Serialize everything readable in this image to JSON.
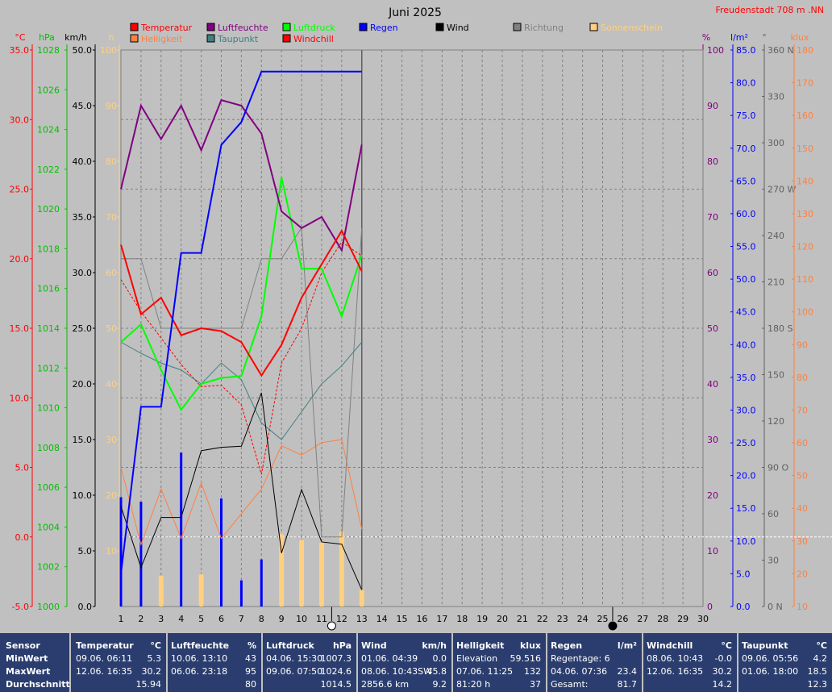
{
  "header": {
    "title": "Juni 2025",
    "location": "Freudenstadt 708 m  .NN"
  },
  "legend": [
    {
      "label": "Temperatur",
      "color": "#ff0000"
    },
    {
      "label": "Luftfeuchte",
      "color": "#800080"
    },
    {
      "label": "Luftdruck",
      "color": "#00ff00"
    },
    {
      "label": "Regen",
      "color": "#0000ff"
    },
    {
      "label": "Wind",
      "color": "#000000"
    },
    {
      "label": "Richtung",
      "color": "#808080"
    },
    {
      "label": "Sonnenschein",
      "color": "#ffd080"
    },
    {
      "label": "Helligkeit",
      "color": "#ff8040"
    },
    {
      "label": "Taupunkt",
      "color": "#408080"
    },
    {
      "label": "Windchill",
      "color": "#ff0000"
    }
  ],
  "axes": {
    "temp": {
      "unit": "°C",
      "ticks": [
        "35.0",
        "30.0",
        "25.0",
        "20.0",
        "15.0",
        "10.0",
        "5.0",
        "0.0",
        "-5.0"
      ],
      "color": "#ff0000"
    },
    "press": {
      "unit": "hPa",
      "ticks": [
        "1028",
        "1026",
        "1024",
        "1022",
        "1020",
        "1018",
        "1016",
        "1014",
        "1012",
        "1010",
        "1008",
        "1006",
        "1004",
        "1002",
        "1000"
      ],
      "color": "#00c000"
    },
    "wind": {
      "unit": "km/h",
      "ticks": [
        "50.0",
        "45.0",
        "40.0",
        "35.0",
        "30.0",
        "25.0",
        "20.0",
        "15.0",
        "10.0",
        "5.0",
        "0.0"
      ],
      "color": "#000000"
    },
    "sun": {
      "unit": "h",
      "ticks": [
        "100",
        "90",
        "80",
        "70",
        "60",
        "50",
        "40",
        "30",
        "20",
        "10"
      ],
      "color": "#ffd080"
    },
    "hum": {
      "unit": "%",
      "ticks": [
        "100",
        "90",
        "80",
        "70",
        "60",
        "50",
        "40",
        "30",
        "20",
        "10",
        "0"
      ],
      "color": "#800080"
    },
    "rain": {
      "unit": "l/m²",
      "ticks": [
        "85.0",
        "80.0",
        "75.0",
        "70.0",
        "65.0",
        "60.0",
        "55.0",
        "50.0",
        "45.0",
        "40.0",
        "35.0",
        "30.0",
        "25.0",
        "20.0",
        "15.0",
        "10.0",
        "5.0",
        "0.0"
      ],
      "color": "#0000ff"
    },
    "dir": {
      "unit": "°",
      "ticks": [
        "360 N",
        "330",
        "300",
        "270 W",
        "240",
        "210",
        "180 S",
        "150",
        "120",
        "90  O",
        "60",
        "30",
        "0   N"
      ],
      "color": "#606060"
    },
    "lux": {
      "unit": "klux",
      "ticks": [
        "180",
        "170",
        "160",
        "150",
        "140",
        "130",
        "120",
        "110",
        "100",
        "90",
        "80",
        "70",
        "60",
        "50",
        "40",
        "30",
        "20",
        "10"
      ],
      "color": "#ff8040"
    },
    "days": [
      "1",
      "2",
      "3",
      "4",
      "5",
      "6",
      "7",
      "8",
      "9",
      "10",
      "11",
      "12",
      "13",
      "14",
      "15",
      "16",
      "17",
      "18",
      "19",
      "20",
      "21",
      "22",
      "23",
      "24",
      "25",
      "26",
      "27",
      "28",
      "29",
      "30"
    ]
  },
  "chart_data": {
    "type": "line",
    "title": "Juni 2025",
    "x": [
      1,
      2,
      3,
      4,
      5,
      6,
      7,
      8,
      9,
      10,
      11,
      12,
      13
    ],
    "xlim": [
      1,
      30
    ],
    "grid": true,
    "series": [
      {
        "name": "Temperatur",
        "unit": "°C",
        "color": "#ff0000",
        "width": 2,
        "ylim": [
          -5,
          35
        ],
        "values": [
          21.0,
          16.0,
          17.2,
          14.5,
          15.0,
          14.8,
          14.0,
          11.6,
          13.8,
          17.2,
          19.6,
          22.0,
          19.1
        ]
      },
      {
        "name": "Windchill",
        "unit": "°C",
        "color": "#ff0000",
        "width": 1,
        "dashed": true,
        "ylim": [
          -5,
          35
        ],
        "values": [
          18.5,
          16.2,
          14.3,
          12.4,
          10.8,
          10.9,
          9.5,
          4.5,
          12.5,
          15.0,
          19.0,
          21.2,
          20.2
        ]
      },
      {
        "name": "Taupunkt",
        "unit": "°C",
        "color": "#408080",
        "width": 1,
        "ylim": [
          -5,
          35
        ],
        "values": [
          14.0,
          13.2,
          12.5,
          12.0,
          11.0,
          12.5,
          11.3,
          8.2,
          7.0,
          9.0,
          11.0,
          12.3,
          14.0
        ]
      },
      {
        "name": "Luftfeuchte",
        "unit": "%",
        "color": "#800080",
        "width": 2,
        "ylim": [
          0,
          100
        ],
        "values": [
          75,
          90,
          84,
          90,
          82,
          91,
          90,
          85,
          71,
          68,
          70,
          64,
          83
        ]
      },
      {
        "name": "Luftdruck",
        "unit": "hPa",
        "color": "#00ff00",
        "width": 2,
        "ylim": [
          1000,
          1028
        ],
        "values": [
          1013.3,
          1014.2,
          1011.9,
          1009.9,
          1011.2,
          1011.5,
          1011.6,
          1014.6,
          1021.6,
          1017.0,
          1017.0,
          1014.6,
          1017.7
        ]
      },
      {
        "name": "Regen",
        "unit": "l/m²",
        "color": "#0000ff",
        "width": 2,
        "ylim": [
          0,
          85
        ],
        "values": [
          5.0,
          30.5,
          30.5,
          54.0,
          54.0,
          70.5,
          74.0,
          81.7,
          81.7,
          81.7,
          81.7,
          81.7,
          81.7
        ]
      },
      {
        "name": "Wind",
        "unit": "km/h",
        "color": "#000000",
        "width": 1,
        "ylim": [
          0,
          50
        ],
        "values": [
          9.0,
          3.5,
          8.0,
          8.0,
          14.0,
          14.3,
          14.4,
          19.2,
          4.8,
          10.5,
          5.8,
          5.6,
          1.5
        ]
      },
      {
        "name": "Richtung",
        "unit": "°",
        "color": "#808080",
        "width": 1,
        "ylim": [
          0,
          360
        ],
        "values": [
          225,
          225,
          180,
          180,
          180,
          180,
          180,
          225,
          225,
          245,
          45,
          45,
          245
        ]
      },
      {
        "name": "Helligkeit",
        "unit": "klux",
        "color": "#ff8040",
        "width": 1,
        "ylim": [
          0,
          180
        ],
        "values": [
          45,
          20,
          38,
          22,
          40,
          22,
          30,
          38,
          52,
          49,
          53,
          54,
          25
        ]
      }
    ],
    "bars": [
      {
        "name": "Regen",
        "unit": "l/m²",
        "color": "#0000ff",
        "ylim": [
          0,
          85
        ],
        "values": [
          16.7,
          16.0,
          0,
          23.5,
          0,
          16.5,
          4.0,
          7.2,
          0,
          0,
          0,
          0,
          0
        ]
      },
      {
        "name": "Sonnenschein",
        "unit": "h",
        "color": "#ffd080",
        "ylim": [
          0,
          100
        ],
        "values": [
          0,
          0,
          5.5,
          0,
          5.8,
          0,
          0,
          0,
          13.0,
          12.0,
          11.5,
          13.5,
          3.0
        ]
      }
    ],
    "markers": [
      {
        "day": 11.5,
        "symbol": "full-moon"
      },
      {
        "day": 25.5,
        "symbol": "new-moon"
      }
    ],
    "reference_lines": [
      {
        "axis": "temp",
        "value": 0.0,
        "style": "dashed-white"
      }
    ]
  },
  "stats": {
    "row_labels": [
      "Sensor",
      "MinWert",
      "MaxWert",
      "Durchschnitt"
    ],
    "columns": [
      {
        "name": "Temperatur",
        "unit": "°C",
        "min_date": "09.06.  06:11",
        "min": "5.3",
        "max_date": "12.06.  16:35",
        "max": "30.2",
        "avg": "15.94"
      },
      {
        "name": "Luftfeuchte",
        "unit": "%",
        "min_date": "10.06.  13:10",
        "min": "43",
        "max_date": "06.06.  23:18",
        "max": "95",
        "avg": "80"
      },
      {
        "name": "Luftdruck",
        "unit": "hPa",
        "min_date": "04.06.  15:30",
        "min": "1007.3",
        "max_date": "09.06.  07:50",
        "max": "1024.6",
        "avg": "1014.5"
      },
      {
        "name": "Wind",
        "unit": "km/h",
        "min_date": "01.06.  04:39",
        "min": "0.0",
        "max_date": "08.06.  10:43SW",
        "max": "45.8",
        "avg_label": "2856.6 km",
        "avg": "9.2"
      },
      {
        "name": "Helligkeit",
        "unit": "klux",
        "min_date": "Elevation",
        "min": "59.516",
        "max_date": "07.06.  11:25",
        "max": "132",
        "avg_label": "81:20 h",
        "avg": "37"
      },
      {
        "name": "Regen",
        "unit": "l/m²",
        "min_date": "Regentage: 6",
        "min": "",
        "max_date": "04.06.  07:36",
        "max": "23.4",
        "avg_label": "Gesamt:",
        "avg": "81.7"
      },
      {
        "name": "Windchill",
        "unit": "°C",
        "min_date": "08.06.  10:43",
        "min": "-0.0",
        "max_date": "12.06.  16:35",
        "max": "30.2",
        "avg": "14.2"
      },
      {
        "name": "Taupunkt",
        "unit": "°C",
        "min_date": "09.06.  05:56",
        "min": "4.2",
        "max_date": "01.06.  18:00",
        "max": "18.5",
        "avg": "12.3"
      }
    ]
  }
}
